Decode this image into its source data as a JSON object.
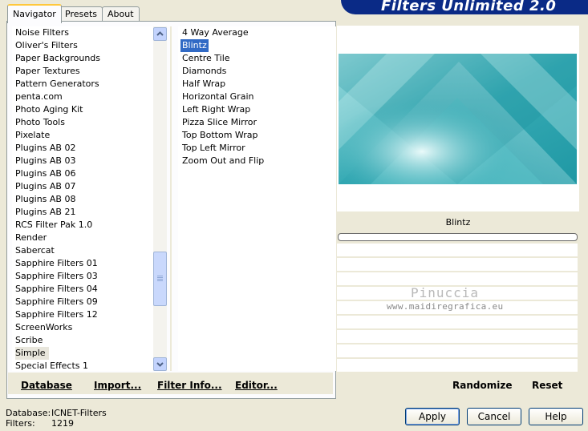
{
  "tabs": [
    {
      "label": "Navigator"
    },
    {
      "label": "Presets"
    },
    {
      "label": "About"
    }
  ],
  "banner": {
    "title": "Filters Unlimited 2.0"
  },
  "categories": [
    "Noise Filters",
    "Oliver's Filters",
    "Paper Backgrounds",
    "Paper Textures",
    "Pattern Generators",
    "penta.com",
    "Photo Aging Kit",
    "Photo Tools",
    "Pixelate",
    "Plugins AB 02",
    "Plugins AB 03",
    "Plugins AB 06",
    "Plugins AB 07",
    "Plugins AB 08",
    "Plugins AB 21",
    "RCS Filter Pak 1.0",
    "Render",
    "Sabercat",
    "Sapphire Filters 01",
    "Sapphire Filters 03",
    "Sapphire Filters 04",
    "Sapphire Filters 09",
    "Sapphire Filters 12",
    "ScreenWorks",
    "Scribe",
    "Simple",
    "Special Effects 1"
  ],
  "selected_category": "Simple",
  "filters": [
    "4 Way Average",
    "Blintz",
    "Centre Tile",
    "Diamonds",
    "Half Wrap",
    "Horizontal Grain",
    "Left Right Wrap",
    "Pizza Slice Mirror",
    "Top Bottom Wrap",
    "Top Left Mirror",
    "Zoom Out and Flip"
  ],
  "selected_filter": "Blintz",
  "links": {
    "database": "Database",
    "import": "Import...",
    "filter_info": "Filter Info...",
    "editor": "Editor...",
    "randomize": "Randomize",
    "reset": "Reset"
  },
  "preview": {
    "filter_name": "Blintz",
    "progress": 0
  },
  "watermark": {
    "name": "Pinuccia",
    "url": "www.maidiregrafica.eu"
  },
  "status": {
    "database_label": "Database:",
    "database_value": "ICNET-Filters",
    "filters_label": "Filters:",
    "filters_value": "1219"
  },
  "buttons": {
    "apply": "Apply",
    "cancel": "Cancel",
    "help": "Help"
  },
  "colors": {
    "banner": "#0a2a86",
    "selection": "#316ac5",
    "preview_teal": "#2fa8b3"
  }
}
